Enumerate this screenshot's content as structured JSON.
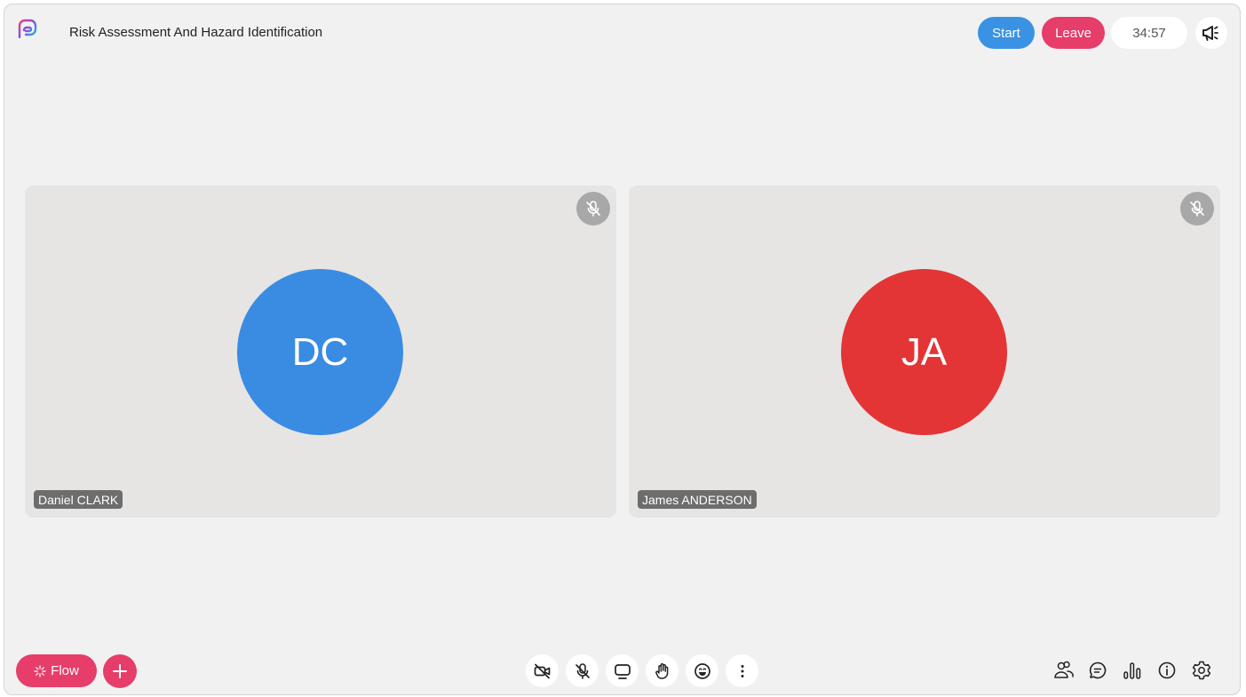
{
  "header": {
    "meeting_title": "Risk Assessment And Hazard Identification",
    "start_label": "Start",
    "leave_label": "Leave",
    "timer": "34:57",
    "announce_icon": "megaphone-icon"
  },
  "participants": [
    {
      "initials": "DC",
      "name": "Daniel CLARK",
      "avatar_color": "#3a8ce3",
      "muted": true
    },
    {
      "initials": "JA",
      "name": "James ANDERSON",
      "avatar_color": "#e33535",
      "muted": true
    }
  ],
  "bottom_left": {
    "flow_label": "Flow",
    "flow_icon": "sparkle-icon",
    "add_icon": "plus-icon"
  },
  "controls": [
    "camera-off-icon",
    "mic-off-icon",
    "screen-share-icon",
    "raise-hand-icon",
    "emoji-icon",
    "more-icon"
  ],
  "bottom_right": [
    "participants-icon",
    "chat-icon",
    "stats-icon",
    "info-icon",
    "settings-icon"
  ],
  "colors": {
    "accent_blue": "#3a92e4",
    "accent_pink": "#e63d6b",
    "background": "#f1f1f1",
    "tile_background": "#e6e5e4"
  }
}
